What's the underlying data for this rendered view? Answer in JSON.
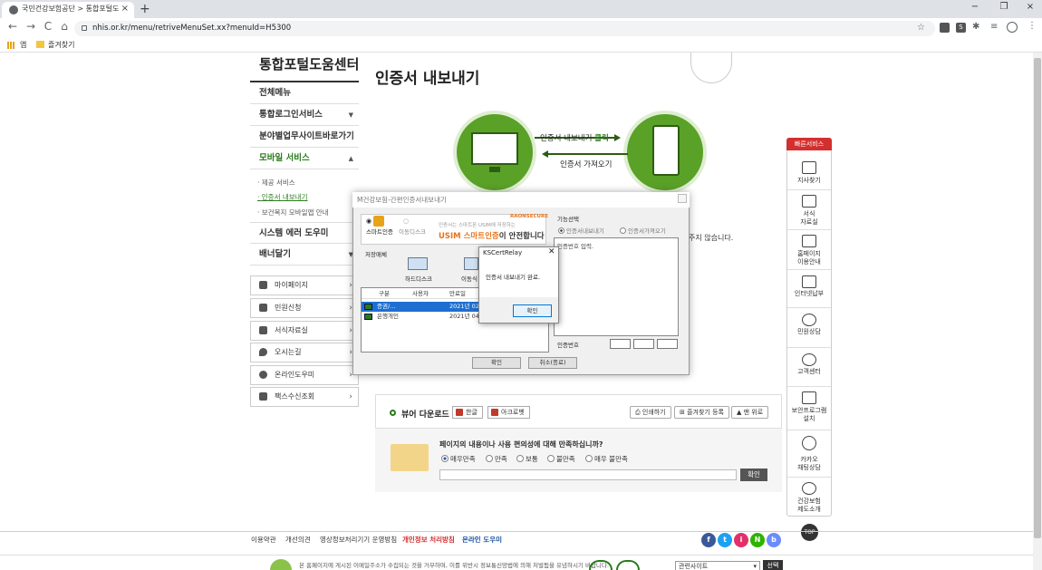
{
  "browser": {
    "tab_title": "국민건강보험공단 > 통합포털도",
    "tab_close": "×",
    "new_tab": "+",
    "url": "nhis.or.kr/menu/retriveMenuSet.xx?menuId=H5300",
    "bookmarks": {
      "apps_label": "앱",
      "fav_label": "즐겨찾기"
    },
    "win_min": "−",
    "win_max": "❐",
    "win_close": "×",
    "back": "←",
    "forward": "→",
    "reload": "C",
    "home": "⌂",
    "ext_badge": "S"
  },
  "lnb": {
    "title": "통합포털도움센터",
    "items": [
      {
        "label": "전체메뉴",
        "arrow": ""
      },
      {
        "label": "통합로그인서비스",
        "arrow": "▼"
      },
      {
        "label": "분야별업무사이트바로가기",
        "arrow": ""
      },
      {
        "label": "모바일 서비스",
        "arrow": "▲"
      },
      {
        "label": "시스템 에러 도우미",
        "arrow": ""
      },
      {
        "label": "배너달기",
        "arrow": "▼"
      }
    ],
    "sub_items": [
      "제공 서비스",
      "인증서 내보내기",
      "보건복지 모바일앱 안내"
    ],
    "quick": [
      {
        "label": "마이페이지",
        "arrow": "›"
      },
      {
        "label": "민원신청",
        "arrow": "›"
      },
      {
        "label": "서식자료실",
        "arrow": "›"
      },
      {
        "label": "오시는길",
        "arrow": "›"
      },
      {
        "label": "온라인도우미",
        "arrow": "›"
      },
      {
        "label": "팩스수신조회",
        "arrow": "›"
      }
    ]
  },
  "main": {
    "title": "인증서 내보내기",
    "flow_export_a": "인증서 내보내기 ",
    "flow_export_b": "클릭",
    "flow_import": "인증서 가져오기",
    "bg_note": "주지 않습니다."
  },
  "viewer": {
    "title": "뷰어 다운로드",
    "hwp": "한글",
    "acrobat": "아크로벳",
    "print": "인쇄하기",
    "bookmark": "즐겨찾기 등록",
    "top": "▲ 맨 위로"
  },
  "survey": {
    "question": "페이지의 내용이나 사용 편의성에 대해 만족하십니까?",
    "options": [
      "매우만족",
      "만족",
      "보통",
      "불만족",
      "매우 불만족"
    ],
    "selected": "매우만족",
    "submit": "확인"
  },
  "quick_service": {
    "header": "빠른서비스",
    "items": [
      "지사찾기",
      "서식\n자료실",
      "홈페이지\n이용안내",
      "인터넷납부",
      "민원상담",
      "고객센터",
      "보안프로그램\n설치",
      "카카오\n채팅상담",
      "건강보험\n제도소개"
    ],
    "top": "TOP"
  },
  "footer": {
    "links": [
      {
        "label": "이용약관",
        "style": "normal"
      },
      {
        "label": "개선의견",
        "style": "normal"
      },
      {
        "label": "영상정보처리기기 운영방침",
        "style": "normal"
      },
      {
        "label": "개인정보 처리방침",
        "style": "red"
      },
      {
        "label": "온라인 도우미",
        "style": "blue"
      }
    ],
    "sns": [
      "f",
      "t",
      "i",
      "N",
      "b"
    ],
    "sns_colors": [
      "#3b5998",
      "#1da1f2",
      "#e1306c",
      "#2db400",
      "#6b8cff"
    ],
    "copyright": "본 홈페이지에 게시된 이메일주소가 수집되는 것을 거부하며, 이를 위반시 정보통신망법에 의해 처벌됨을 유념하시기 바랍니다.",
    "related": "관련사이트",
    "related_go": "선택"
  },
  "cert_dialog": {
    "title": "M건강보험-간편인증서내보내기",
    "tab_smart": "스마트인증",
    "tab_removable": "이동디스크",
    "banner_small": "인증서는 스마트폰 USIM에 저장하는",
    "banner_main_a": "USIM 스마트인증",
    "banner_main_b": "이 안전합니다",
    "banner_logo": "RAONSECURE",
    "storage_label": "저장매체",
    "hdd": "하드디스크",
    "removable": "이동식",
    "list_headers": [
      "구분",
      "사용자",
      "만료일"
    ],
    "rows": [
      {
        "kind": "증권/...",
        "user": "",
        "expiry": "2021년 02"
      },
      {
        "kind": "은행개인",
        "user": "",
        "expiry": "2021년 04"
      }
    ],
    "fn_label": "기능선택",
    "fn_export": "인증서내보내기",
    "fn_import": "인증서가져오기",
    "pw_placeholder": "인증번호 입력.",
    "cert_no_label": "인증번호",
    "ok": "확인",
    "cancel": "취소(종료)"
  },
  "alert": {
    "title": "KSCertRelay",
    "close": "✕",
    "message": "인증서 내보내기 완료.",
    "ok": "확인"
  }
}
